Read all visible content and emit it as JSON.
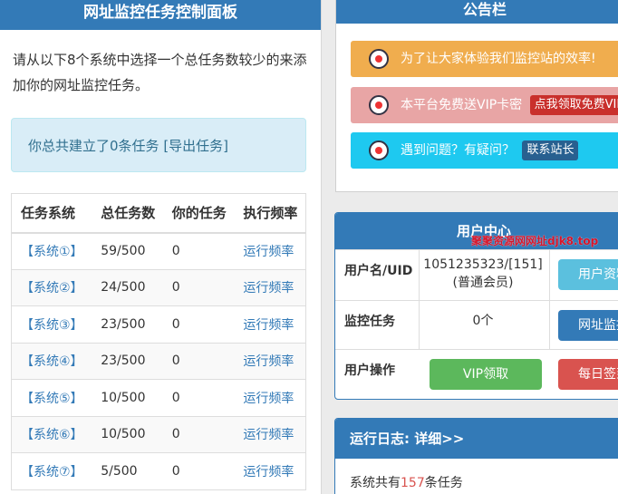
{
  "left": {
    "title": "网址监控任务控制面板",
    "intro": "请从以下8个系统中选择一个总任务数较少的来添加你的网址监控任务。",
    "info_text": "你总共建立了0条任务",
    "info_link": "[导出任务]",
    "table": {
      "headers": [
        "任务系统",
        "总任务数",
        "你的任务",
        "执行频率"
      ],
      "rows": [
        [
          "【系统①】",
          "59/500",
          "0",
          "运行频率"
        ],
        [
          "【系统②】",
          "24/500",
          "0",
          "运行频率"
        ],
        [
          "【系统③】",
          "23/500",
          "0",
          "运行频率"
        ],
        [
          "【系统④】",
          "23/500",
          "0",
          "运行频率"
        ],
        [
          "【系统⑤】",
          "10/500",
          "0",
          "运行频率"
        ],
        [
          "【系统⑥】",
          "10/500",
          "0",
          "运行频率"
        ],
        [
          "【系统⑦】",
          "5/500",
          "0",
          "运行频率"
        ]
      ]
    }
  },
  "notice": {
    "title": "公告栏",
    "items": [
      {
        "text": "为了让大家体验我们监控站的效率!",
        "button": ""
      },
      {
        "text": "本平台免费送VIP卡密",
        "button": "点我领取免费VIP"
      },
      {
        "text": "遇到问题？有疑问？",
        "button": "联系站长"
      }
    ]
  },
  "user": {
    "title": "用户中心",
    "watermark": "聚聚资源网网址djk8.top",
    "rows": {
      "uid_label": "用户名/UID",
      "uid_value": "1051235323/[151]",
      "member_level": "(普通会员)",
      "profile_button": "用户资料",
      "task_label": "监控任务",
      "task_value": "0个",
      "monitor_button": "网址监控",
      "ops_label": "用户操作",
      "vip_button": "VIP领取",
      "signin_button": "每日签到"
    }
  },
  "log": {
    "title": "运行日志: 详细>>",
    "prefix": "系统共有",
    "count": "157",
    "suffix": "条任务"
  },
  "colors": {
    "primary": "#337ab7",
    "warning": "#f0ad4e",
    "info": "#5bc0de",
    "success": "#5cb85c",
    "danger": "#d9534f"
  }
}
